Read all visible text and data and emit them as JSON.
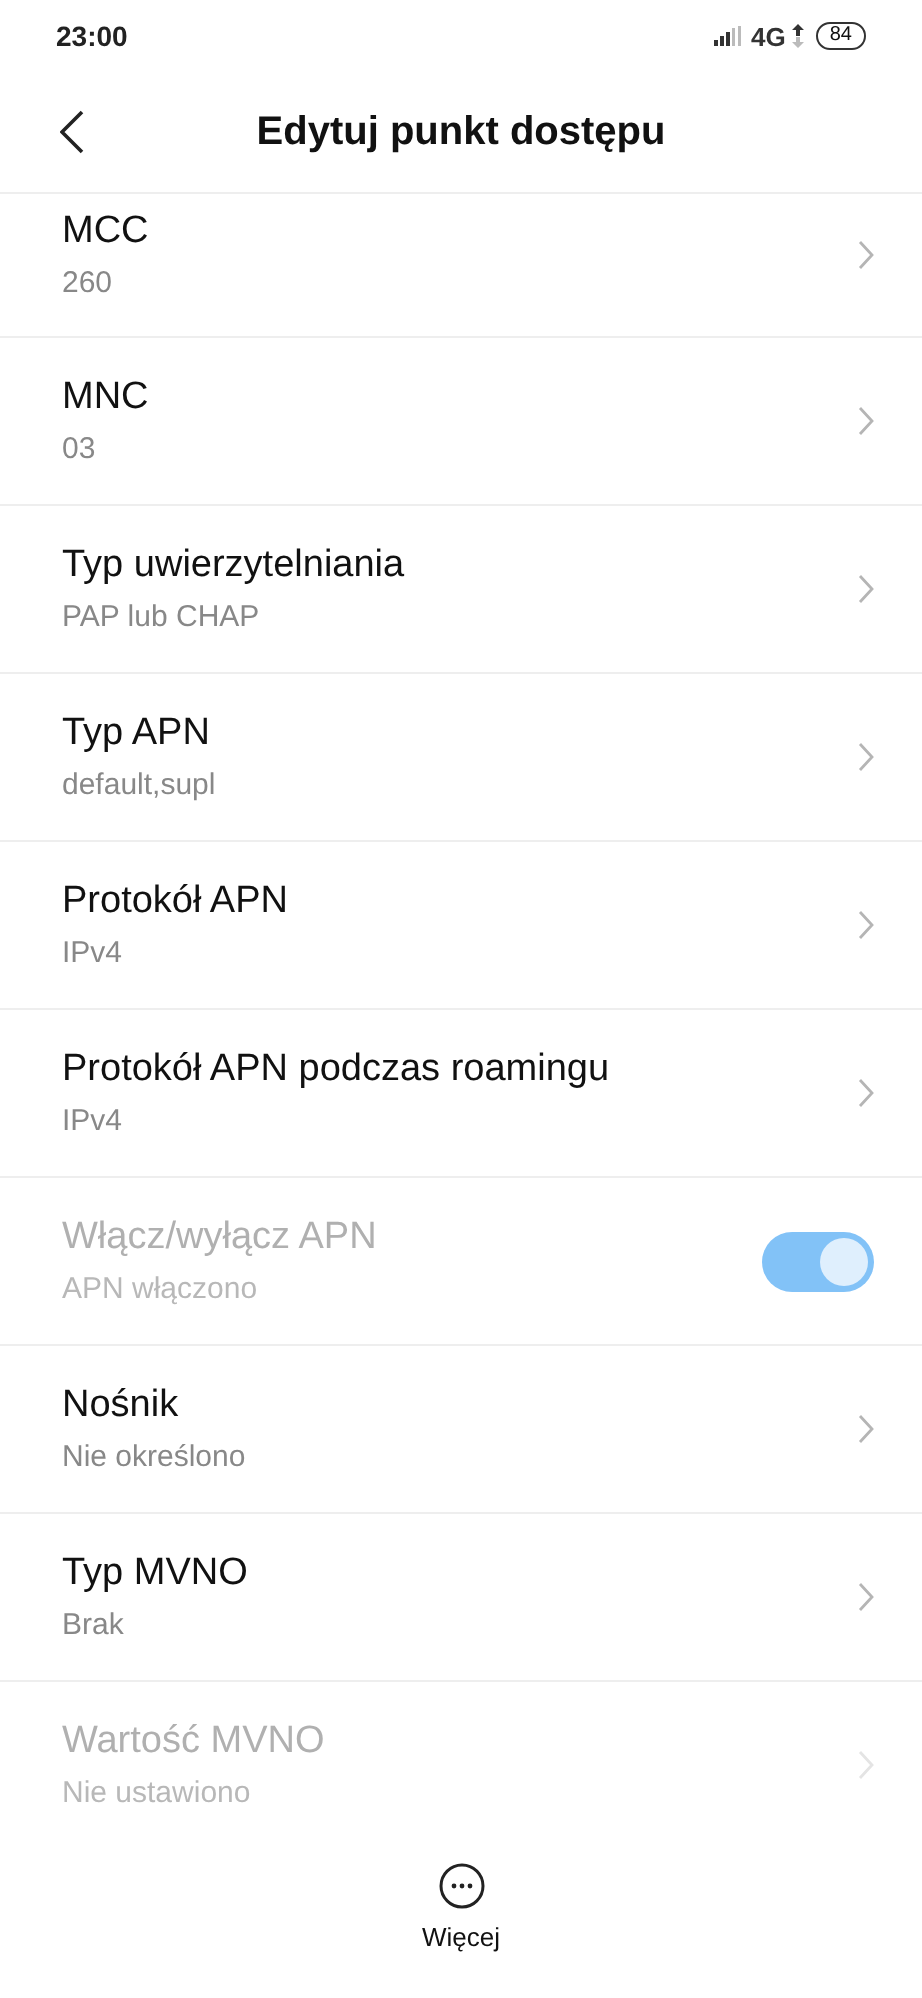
{
  "status_bar": {
    "time": "23:00",
    "network": "4G",
    "battery": "84"
  },
  "header": {
    "title": "Edytuj punkt dostępu"
  },
  "items": [
    {
      "kind": "chevron",
      "title": "MCC",
      "value": "260",
      "disabled": false
    },
    {
      "kind": "chevron",
      "title": "MNC",
      "value": "03",
      "disabled": false
    },
    {
      "kind": "chevron",
      "title": "Typ uwierzytelniania",
      "value": "PAP lub CHAP",
      "disabled": false
    },
    {
      "kind": "chevron",
      "title": "Typ APN",
      "value": "default,supl",
      "disabled": false
    },
    {
      "kind": "chevron",
      "title": "Protokół APN",
      "value": "IPv4",
      "disabled": false
    },
    {
      "kind": "chevron",
      "title": "Protokół APN podczas roamingu",
      "value": "IPv4",
      "disabled": false
    },
    {
      "kind": "toggle",
      "title": "Włącz/wyłącz APN",
      "value": "APN włączono",
      "disabled": true,
      "on": true
    },
    {
      "kind": "chevron",
      "title": "Nośnik",
      "value": "Nie określono",
      "disabled": false
    },
    {
      "kind": "chevron",
      "title": "Typ MVNO",
      "value": "Brak",
      "disabled": false
    },
    {
      "kind": "chevron",
      "title": "Wartość MVNO",
      "value": "Nie ustawiono",
      "disabled": true
    }
  ],
  "bottom_bar": {
    "label": "Więcej"
  }
}
